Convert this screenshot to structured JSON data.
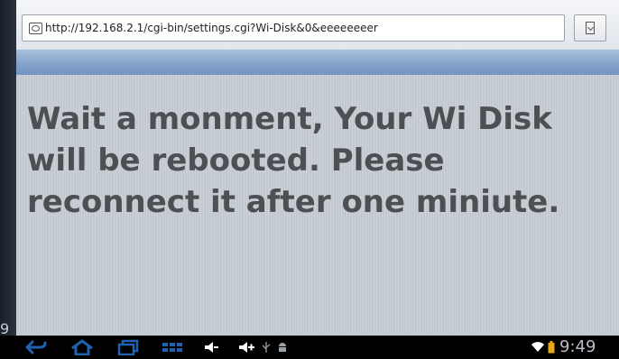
{
  "browser": {
    "url": "http://192.168.2.1/cgi-bin/settings.cgi?Wi-Disk&0&eeeeeeeer"
  },
  "page": {
    "message": "Wait a monment, Your Wi Disk will be rebooted. Please reconnect it after one miniute."
  },
  "system_bar": {
    "time": "9:49",
    "left_edge_glyph": "9"
  },
  "icons": {
    "url_bar": "page-icon",
    "bookmark": "bookmark-icon",
    "nav": [
      "back-icon",
      "home-icon",
      "recent-apps-icon",
      "menu-icon",
      "volume-down-icon",
      "volume-up-icon"
    ],
    "status": [
      "usb-icon",
      "android-icon",
      "wifi-icon",
      "battery-icon"
    ]
  },
  "colors": {
    "content_background": "#c6ccd3",
    "message_text": "#4d4f52",
    "blue_band": "#7d9cc6",
    "system_bar": "#000000",
    "nav_icons": "#1e62b0",
    "wifi_icon": "#ffffff",
    "battery_icon": "#e6a817"
  }
}
